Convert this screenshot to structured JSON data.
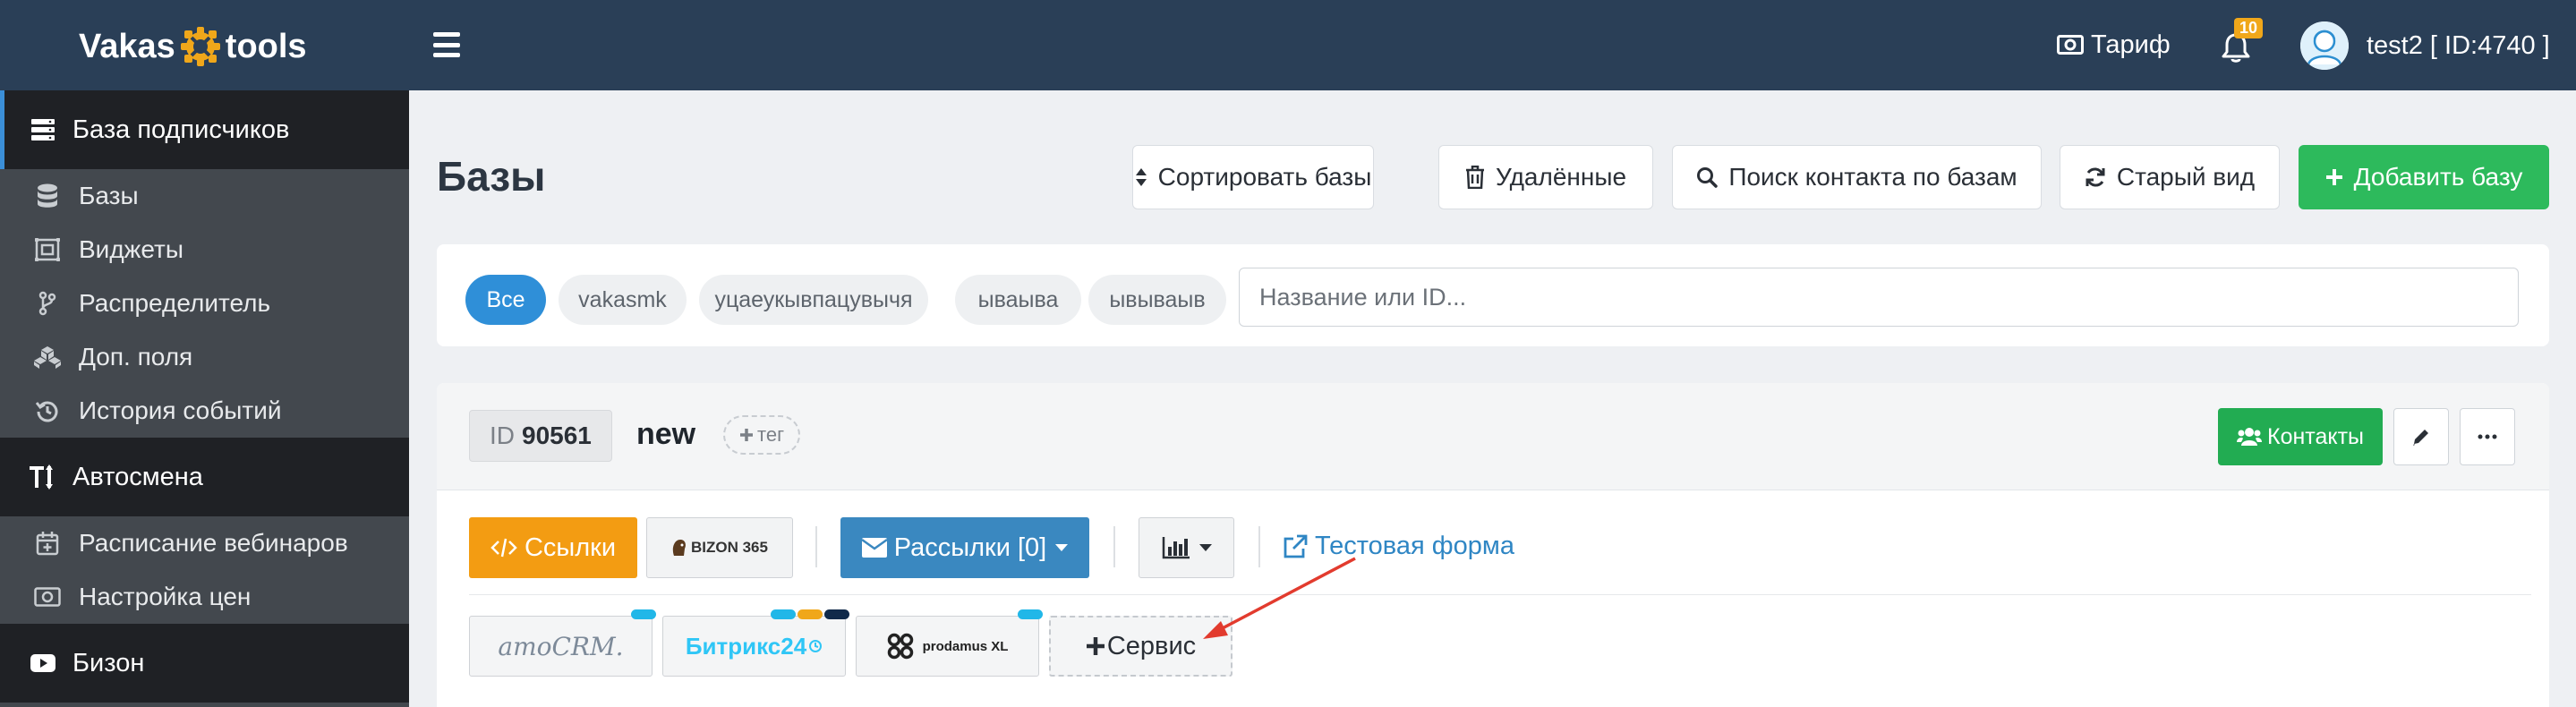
{
  "header": {
    "logo_left": "Vakas",
    "logo_right": "tools",
    "tariff_label": "Тариф",
    "notifications_count": "10",
    "user_label": "test2 [ ID:4740 ]"
  },
  "sidebar": {
    "sections": [
      {
        "label": "База подписчиков",
        "icon": "server-icon"
      },
      {
        "label": "Автосмена",
        "icon": "text-height-icon"
      },
      {
        "label": "Бизон",
        "icon": "youtube-icon"
      }
    ],
    "items": [
      {
        "label": "Базы",
        "icon": "database-icon"
      },
      {
        "label": "Виджеты",
        "icon": "widget-icon"
      },
      {
        "label": "Распределитель",
        "icon": "branch-icon"
      },
      {
        "label": "Доп. поля",
        "icon": "cubes-icon"
      },
      {
        "label": "История событий",
        "icon": "history-icon"
      },
      {
        "label": "Расписание вебинаров",
        "icon": "calendar-plus-icon"
      },
      {
        "label": "Настройка цен",
        "icon": "money-icon"
      }
    ]
  },
  "page": {
    "title": "Базы",
    "buttons": {
      "sort": "Сортировать базы",
      "deleted": "Удалённые",
      "search_contact": "Поиск контакта по базам",
      "old_view": "Старый вид",
      "add_base": "Добавить базу"
    }
  },
  "filters": {
    "chips": [
      "Все",
      "vakasmk",
      "уцаеукывпацувычя",
      "ываыва",
      "ывываыв"
    ],
    "active_index": 0,
    "search_placeholder": "Название или ID..."
  },
  "base": {
    "id_label": "ID",
    "id_value": "90561",
    "name": "new",
    "tag_label": "тег",
    "contacts_label": "Контакты",
    "links_label": "Ссылки",
    "bizon_label": "BIZON 365",
    "mailings_label": "Рассылки [0]",
    "test_form_label": "Тестовая форма",
    "services": [
      "amoCRM.",
      "Битрикс24",
      "prodamus XL"
    ],
    "add_service_label": "Сервис"
  },
  "colors": {
    "topbar": "#2a3f57",
    "green": "#2dba5c",
    "orange": "#f39c12",
    "blue": "#3a88c0",
    "link": "#2f86c4",
    "arrow": "#e23b2e"
  }
}
